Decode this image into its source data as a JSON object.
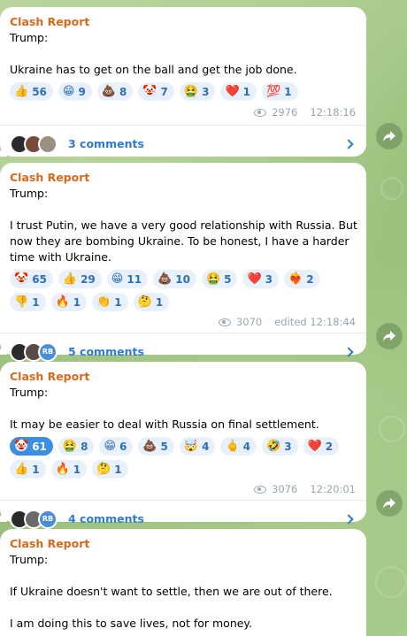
{
  "posts": [
    {
      "author": "Clash Report",
      "text": "Trump:\n\nUkraine has to get on the ball and get the job done.",
      "reactions": [
        {
          "emoji": "👍",
          "count": "56",
          "selected": false
        },
        {
          "emoji": "😁",
          "count": "9",
          "selected": false
        },
        {
          "emoji": "💩",
          "count": "8",
          "selected": false
        },
        {
          "emoji": "🤡",
          "count": "7",
          "selected": false
        },
        {
          "emoji": "🤮",
          "count": "3",
          "selected": false
        },
        {
          "emoji": "❤️",
          "count": "1",
          "selected": false
        },
        {
          "emoji": "💯",
          "count": "1",
          "selected": false
        }
      ],
      "views": "2976",
      "time": "12:18:16",
      "comments_label": "3 comments",
      "avatars": [
        {
          "label": "",
          "color": "#2b2b2b"
        },
        {
          "label": "",
          "color": "#7a4b3a"
        },
        {
          "label": "",
          "color": "#9c8f80"
        }
      ]
    },
    {
      "author": "Clash Report",
      "text": "Trump:\n\nI trust Putin, we have a very good relationship with Russia. But now they are bombing Ukraine. To be honest, I have a harder time with Ukraine.",
      "reactions": [
        {
          "emoji": "🤡",
          "count": "65",
          "selected": false
        },
        {
          "emoji": "👍",
          "count": "29",
          "selected": false
        },
        {
          "emoji": "😁",
          "count": "11",
          "selected": false
        },
        {
          "emoji": "💩",
          "count": "10",
          "selected": false
        },
        {
          "emoji": "🤮",
          "count": "5",
          "selected": false
        },
        {
          "emoji": "❤️",
          "count": "3",
          "selected": false
        },
        {
          "emoji": "❤️‍🔥",
          "count": "2",
          "selected": false
        },
        {
          "emoji": "👎",
          "count": "1",
          "selected": false
        },
        {
          "emoji": "🔥",
          "count": "1",
          "selected": false
        },
        {
          "emoji": "👏",
          "count": "1",
          "selected": false
        },
        {
          "emoji": "🤔",
          "count": "1",
          "selected": false
        }
      ],
      "views": "3070",
      "time": "edited 12:18:44",
      "comments_label": "5 comments",
      "avatars": [
        {
          "label": "",
          "color": "#2b2b2b"
        },
        {
          "label": "",
          "color": "#5b4a45"
        },
        {
          "label": "RB",
          "color": "#4a90d9"
        }
      ]
    },
    {
      "author": "Clash Report",
      "text": "Trump:\n\nIt may be easier to deal with Russia on final settlement.",
      "reactions": [
        {
          "emoji": "🤡",
          "count": "61",
          "selected": true
        },
        {
          "emoji": "🤮",
          "count": "8",
          "selected": false
        },
        {
          "emoji": "😁",
          "count": "6",
          "selected": false
        },
        {
          "emoji": "💩",
          "count": "5",
          "selected": false
        },
        {
          "emoji": "🤯",
          "count": "4",
          "selected": false
        },
        {
          "emoji": "🖕",
          "count": "4",
          "selected": false
        },
        {
          "emoji": "🤣",
          "count": "3",
          "selected": false
        },
        {
          "emoji": "❤️",
          "count": "2",
          "selected": false
        },
        {
          "emoji": "👍",
          "count": "1",
          "selected": false
        },
        {
          "emoji": "🔥",
          "count": "1",
          "selected": false
        },
        {
          "emoji": "🤔",
          "count": "1",
          "selected": false
        }
      ],
      "views": "3076",
      "time": "12:20:01",
      "comments_label": "4 comments",
      "avatars": [
        {
          "label": "",
          "color": "#2b2b2b"
        },
        {
          "label": "",
          "color": "#6a6a6a"
        },
        {
          "label": "RB",
          "color": "#4a90d9"
        }
      ]
    },
    {
      "author": "Clash Report",
      "text": "Trump:\n\nIf Ukraine doesn't want to settle, then we are out of there.\n\nI am doing this to save lives, not for money.",
      "reactions": [],
      "views": "",
      "time": "",
      "comments_label": "",
      "avatars": []
    }
  ]
}
